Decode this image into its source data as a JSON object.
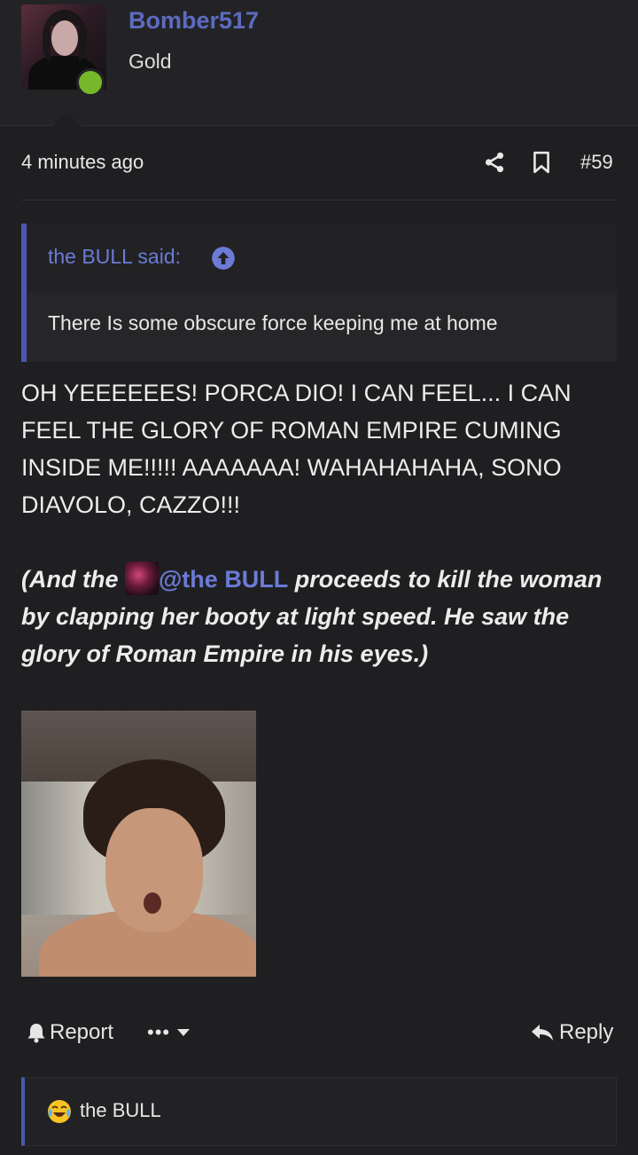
{
  "user": {
    "name": "Bomber517",
    "title": "Gold",
    "online_color": "#76b82a",
    "name_color": "#5c6bc0"
  },
  "meta": {
    "time": "4 minutes ago",
    "post_number": "#59",
    "share_icon": "share-icon",
    "bookmark_icon": "bookmark-icon"
  },
  "quote": {
    "author_label": "the BULL said:",
    "up_icon": "arrow-up-circle-icon",
    "text": "There Is some obscure force keeping me at home"
  },
  "post": {
    "body": "OH YEEEEEES! PORCA DIO! I CAN FEEL... I CAN FEEL THE GLORY OF ROMAN EMPIRE CUMING INSIDE ME!!!!! AAAAAAA! WAHAHAHAHA, SONO DIAVOLO, CAZZO!!!",
    "italic_prefix": "(And the ",
    "mention": "@the BULL",
    "italic_suffix": " proceeds to kill the woman by clapping her booty at light speed. He saw the glory of Roman Empire in his eyes.)"
  },
  "actions": {
    "report": "Report",
    "more": "•••",
    "reply": "Reply"
  },
  "reactions": {
    "emoji_icon": "laughing-crying-emoji-icon",
    "user": "the BULL"
  },
  "accent_color": "#4c57b0"
}
